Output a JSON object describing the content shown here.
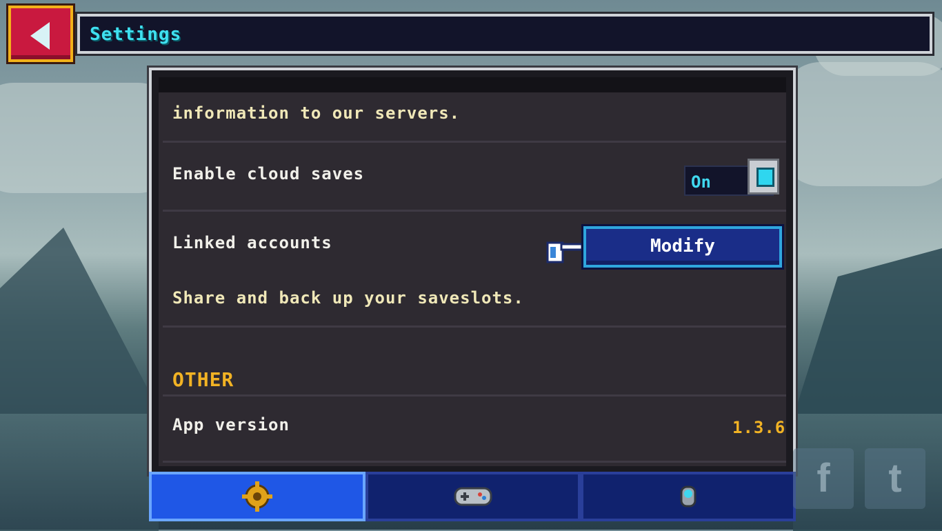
{
  "header": {
    "title": "Settings",
    "back_icon": "back-arrow-icon"
  },
  "settings": {
    "partial_description": "information to our servers.",
    "cloud_saves": {
      "label": "Enable cloud saves",
      "toggle_value": "On"
    },
    "linked_accounts": {
      "label": "Linked accounts",
      "button_label": "Modify",
      "description": "Share and back up your saveslots."
    },
    "other_section": {
      "heading": "OTHER",
      "app_version_label": "App version",
      "app_version_value": "1.3.6"
    }
  },
  "tabs": [
    {
      "icon": "gear-icon",
      "active": true
    },
    {
      "icon": "gamepad-icon",
      "active": false
    },
    {
      "icon": "orb-icon",
      "active": false
    }
  ],
  "social": [
    {
      "icon": "facebook-icon",
      "glyph": "f"
    },
    {
      "icon": "twitter-icon",
      "glyph": "t"
    }
  ],
  "colors": {
    "accent_cyan": "#3fe0f0",
    "accent_gold": "#f2b324",
    "back_button_red": "#c9193f",
    "tab_active_blue": "#1f57e6"
  }
}
